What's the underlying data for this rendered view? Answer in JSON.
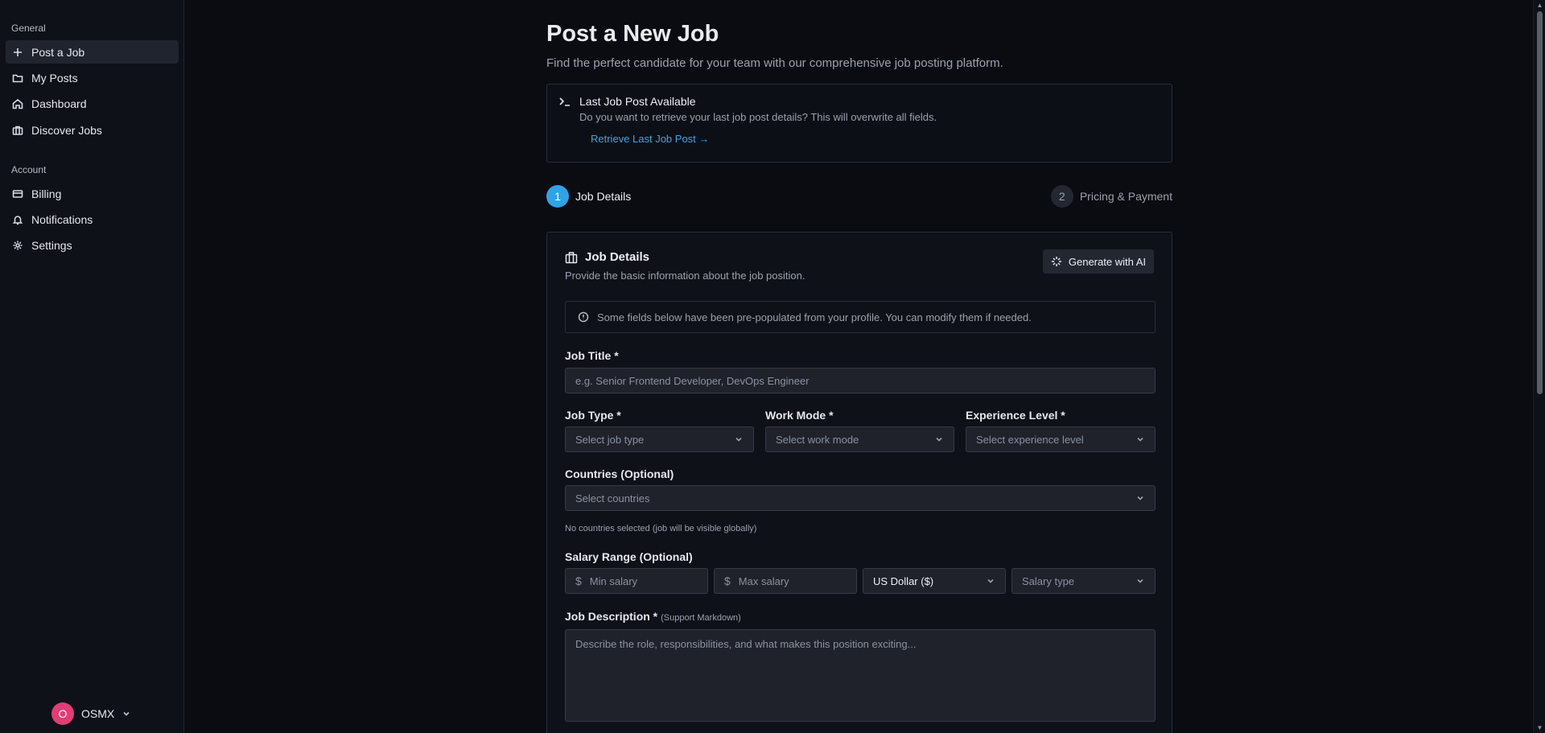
{
  "sidebar": {
    "groups": [
      {
        "title": "General",
        "items": [
          {
            "label": "Post a Job",
            "icon": "plus-icon",
            "active": true
          },
          {
            "label": "My Posts",
            "icon": "folder-icon"
          },
          {
            "label": "Dashboard",
            "icon": "home-icon"
          },
          {
            "label": "Discover Jobs",
            "icon": "briefcase-icon"
          }
        ]
      },
      {
        "title": "Account",
        "items": [
          {
            "label": "Billing",
            "icon": "credit-card-icon"
          },
          {
            "label": "Notifications",
            "icon": "bell-icon"
          },
          {
            "label": "Settings",
            "icon": "gear-icon"
          }
        ]
      }
    ],
    "user": {
      "initial": "O",
      "name": "OSMX",
      "avatar_color": "#e23d74"
    }
  },
  "header": {
    "title": "Post a New Job",
    "subtitle": "Find the perfect candidate for your team with our comprehensive job posting platform."
  },
  "retrieve": {
    "title": "Last Job Post Available",
    "description": "Do you want to retrieve your last job post details? This will overwrite all fields.",
    "link": "Retrieve Last Job Post →"
  },
  "steps": [
    {
      "number": "1",
      "label": "Job Details",
      "active": true
    },
    {
      "number": "2",
      "label": "Pricing & Payment",
      "active": false
    }
  ],
  "card": {
    "title": "Job Details",
    "description": "Provide the basic information about the job position.",
    "ai_button": "Generate with AI",
    "info": "Some fields below have been pre-populated from your profile. You can modify them if needed.",
    "job_title": {
      "label": "Job Title *",
      "placeholder": "e.g. Senior Frontend Developer, DevOps Engineer"
    },
    "job_type": {
      "label": "Job Type *",
      "placeholder": "Select job type"
    },
    "work_mode": {
      "label": "Work Mode *",
      "placeholder": "Select work mode"
    },
    "experience": {
      "label": "Experience Level *",
      "placeholder": "Select experience level"
    },
    "countries": {
      "label": "Countries (Optional)",
      "placeholder": "Select countries",
      "helper": "No countries selected (job will be visible globally)"
    },
    "salary": {
      "label": "Salary Range (Optional)",
      "currency_symbol": "$",
      "min_placeholder": "Min salary",
      "max_placeholder": "Max salary",
      "currency": "US Dollar ($)",
      "type_placeholder": "Salary type"
    },
    "description_field": {
      "label": "Job Description *",
      "sublabel": "(Support Markdown)",
      "placeholder": "Describe the role, responsibilities, and what makes this position exciting..."
    }
  },
  "colors": {
    "accent": "#2ea3e6",
    "link": "#3aa3f0",
    "background": "#0a0c12"
  }
}
